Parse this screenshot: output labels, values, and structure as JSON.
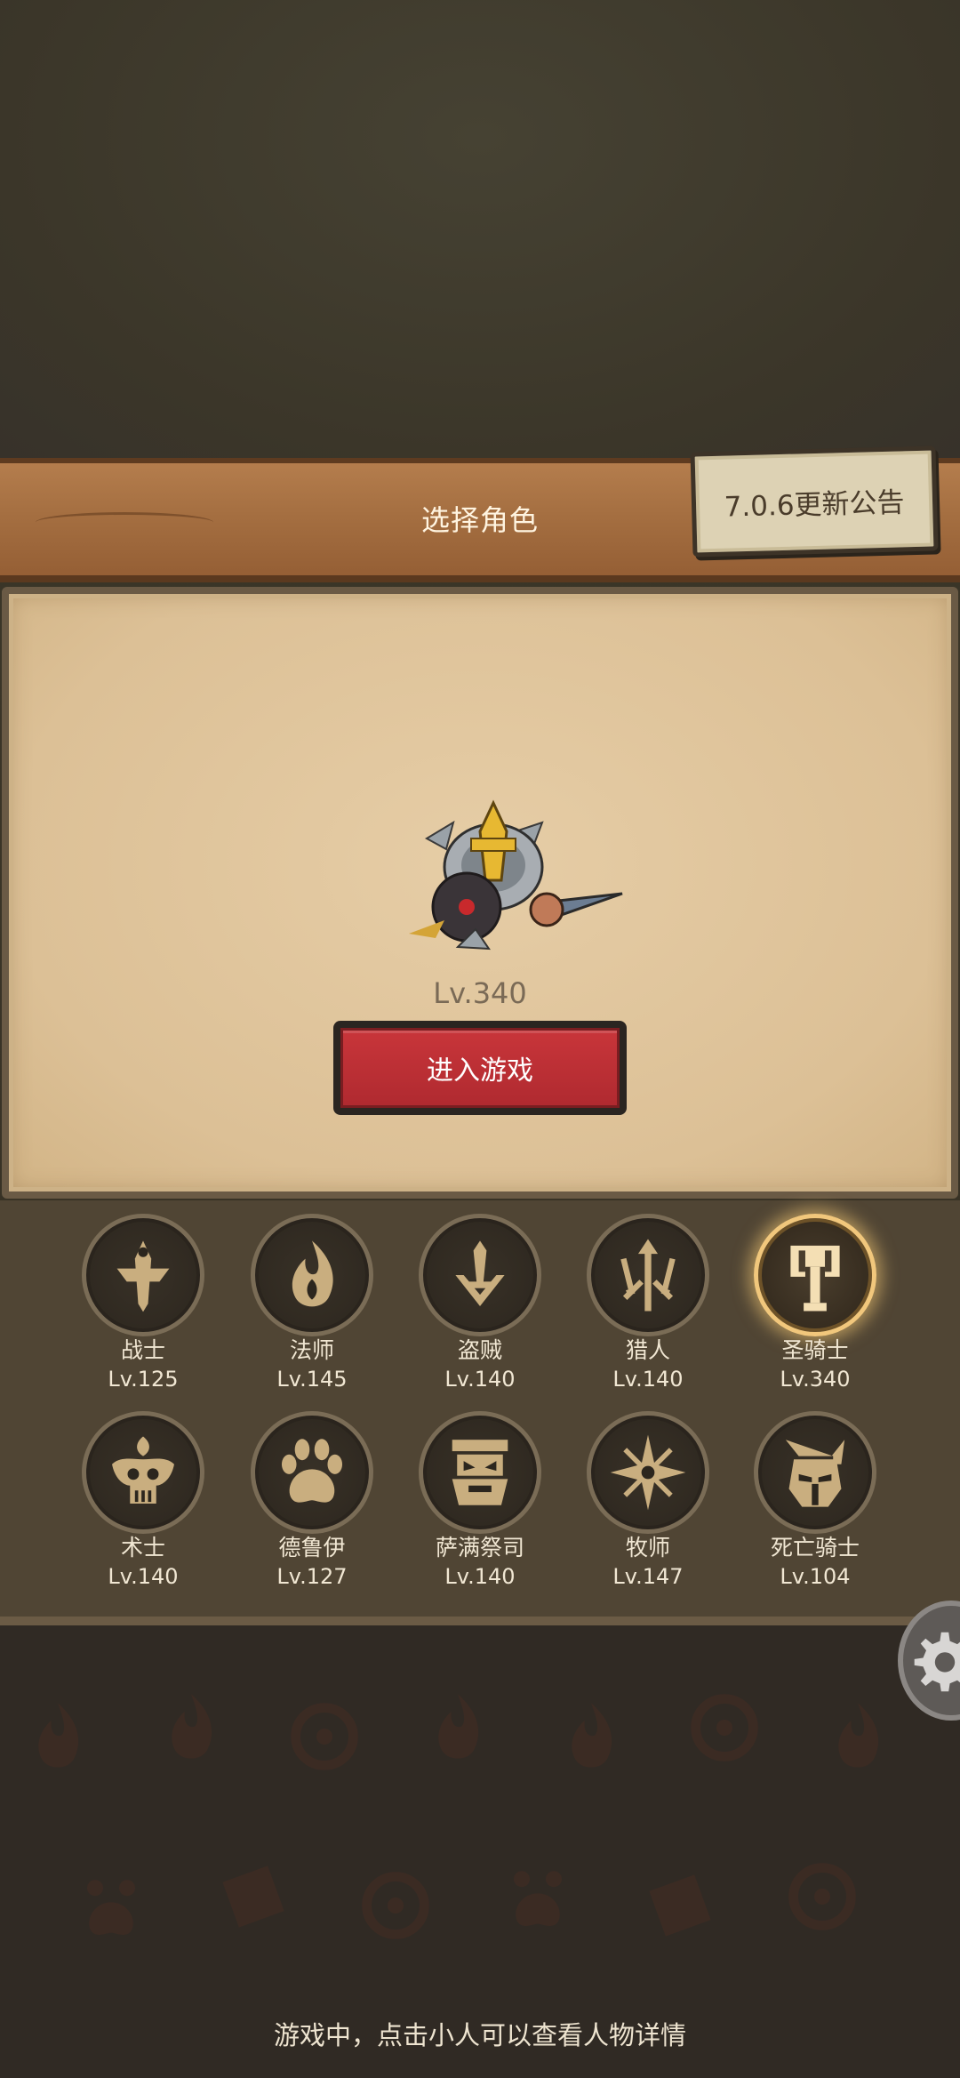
{
  "header": {
    "title": "选择角色",
    "notice_button": "7.0.6更新公告"
  },
  "selected_hero": {
    "level": "Lv.340",
    "enter_button": "进入游戏"
  },
  "classes": [
    {
      "name": "战士",
      "level": "Lv.125",
      "icon": "warrior-sword-icon"
    },
    {
      "name": "法师",
      "level": "Lv.145",
      "icon": "mage-flame-icon"
    },
    {
      "name": "盗贼",
      "level": "Lv.140",
      "icon": "rogue-daggers-icon"
    },
    {
      "name": "猎人",
      "level": "Lv.140",
      "icon": "hunter-arrows-icon"
    },
    {
      "name": "圣骑士",
      "level": "Lv.340",
      "icon": "paladin-hammer-icon",
      "selected": true
    },
    {
      "name": "术士",
      "level": "Lv.140",
      "icon": "warlock-skull-icon"
    },
    {
      "name": "德鲁伊",
      "level": "Lv.127",
      "icon": "druid-paw-icon"
    },
    {
      "name": "萨满祭司",
      "level": "Lv.140",
      "icon": "shaman-totem-icon"
    },
    {
      "name": "牧师",
      "level": "Lv.147",
      "icon": "priest-star-icon"
    },
    {
      "name": "死亡骑士",
      "level": "Lv.104",
      "icon": "death-knight-helm-icon"
    }
  ],
  "footer": {
    "hint": "游戏中，点击小人可以查看人物详情"
  },
  "colors": {
    "accent_gold": "#f1c77c",
    "icon_tan": "#c9ae7f",
    "button_red": "#c8353a"
  }
}
